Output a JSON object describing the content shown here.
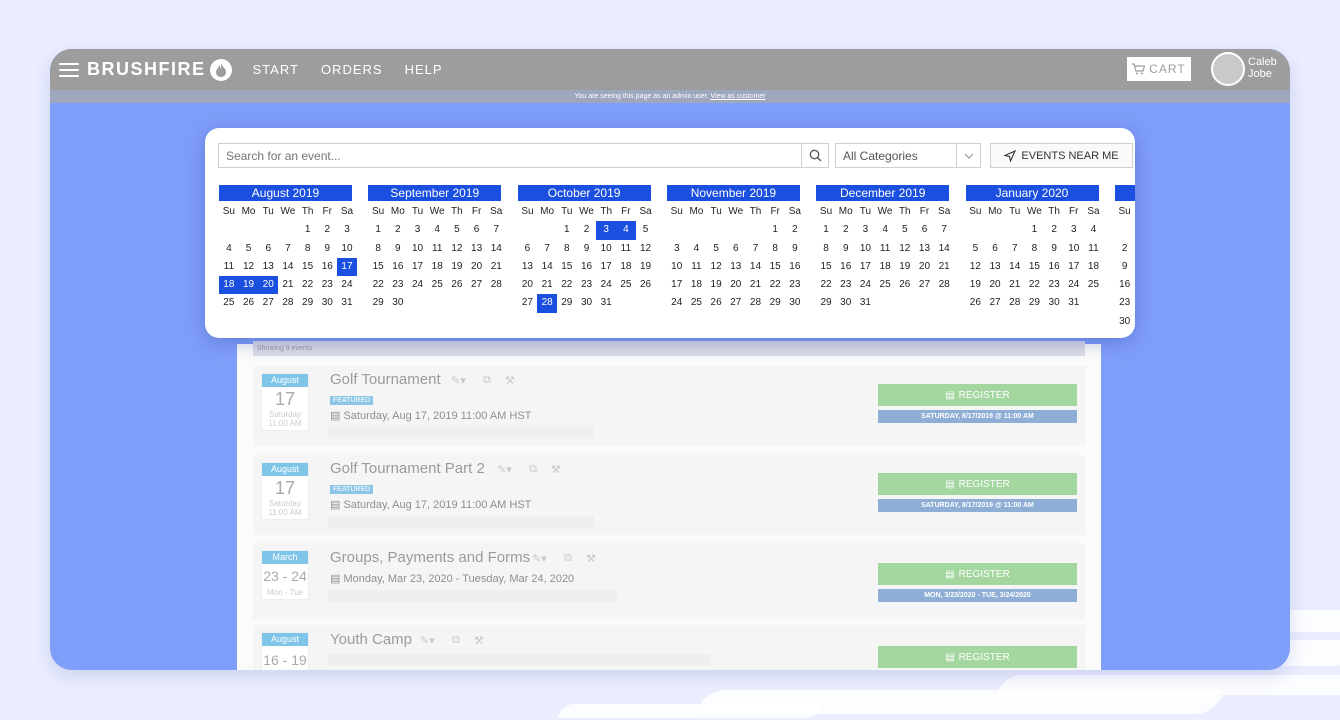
{
  "brand": "BRUSHFIRE",
  "nav": [
    "START",
    "ORDERS",
    "HELP"
  ],
  "cart_label": "CART",
  "user": {
    "first": "Caleb",
    "last": "Jobe"
  },
  "admin": {
    "text": "You are seeing this page as an admin user.",
    "link": "View as customer"
  },
  "search": {
    "placeholder": "Search for an event..."
  },
  "category": {
    "selected": "All Categories"
  },
  "near_label": "EVENTS NEAR ME",
  "weekdays": [
    "Su",
    "Mo",
    "Tu",
    "We",
    "Th",
    "Fr",
    "Sa"
  ],
  "months": [
    {
      "name": "August 2019",
      "offset": 4,
      "days": 31,
      "selected": [
        17,
        18,
        19,
        20
      ]
    },
    {
      "name": "September 2019",
      "offset": 0,
      "days": 30,
      "selected": []
    },
    {
      "name": "October 2019",
      "offset": 2,
      "days": 31,
      "selected": [
        3,
        4,
        28
      ]
    },
    {
      "name": "November 2019",
      "offset": 5,
      "days": 30,
      "selected": []
    },
    {
      "name": "December 2019",
      "offset": 0,
      "days": 31,
      "selected": []
    },
    {
      "name": "January 2020",
      "offset": 3,
      "days": 31,
      "selected": []
    },
    {
      "name": "",
      "offset": 6,
      "days": 31,
      "selected": []
    }
  ],
  "showing": "Showing 9 events",
  "events": [
    {
      "month": "August",
      "day": "17",
      "sub1": "Saturday",
      "sub2": "11:00 AM",
      "title": "Golf Tournament",
      "featured": "FEATURED",
      "date": "Saturday, Aug 17, 2019 11:00 AM HST",
      "register": "REGISTER",
      "regdate": "SATURDAY, 8/17/2019 @ 11:00 AM"
    },
    {
      "month": "August",
      "day": "17",
      "sub1": "Saturday",
      "sub2": "11:00 AM",
      "title": "Golf Tournament Part 2",
      "featured": "FEATURED",
      "date": "Saturday, Aug 17, 2019 11:00 AM HST",
      "register": "REGISTER",
      "regdate": "SATURDAY, 8/17/2019 @ 11:00 AM"
    },
    {
      "month": "March",
      "day": "23 - 24",
      "sub1": "Mon - Tue",
      "sub2": "",
      "title": "Groups, Payments and Forms",
      "featured": "",
      "date": "Monday, Mar 23, 2020 - Tuesday, Mar 24, 2020",
      "register": "REGISTER",
      "regdate": "MON, 3/23/2020 - TUE, 3/24/2020"
    },
    {
      "month": "August",
      "day": "16 - 19",
      "sub1": "",
      "sub2": "",
      "title": "Youth Camp",
      "featured": "",
      "date": "",
      "register": "REGISTER",
      "regdate": ""
    }
  ]
}
